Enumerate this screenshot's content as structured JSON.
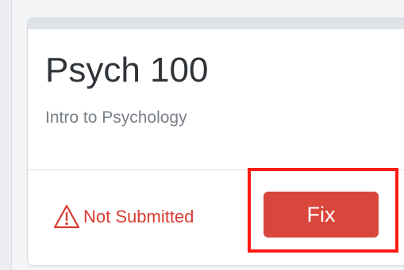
{
  "card": {
    "title": "Psych 100",
    "subtitle": "Intro to Psychology",
    "status": {
      "label": "Not Submitted",
      "icon": "warning-icon",
      "color": "#d73b30"
    },
    "fix_button": {
      "label": "Fix",
      "color": "#d9463c"
    },
    "highlight_color": "#ff1a14"
  }
}
